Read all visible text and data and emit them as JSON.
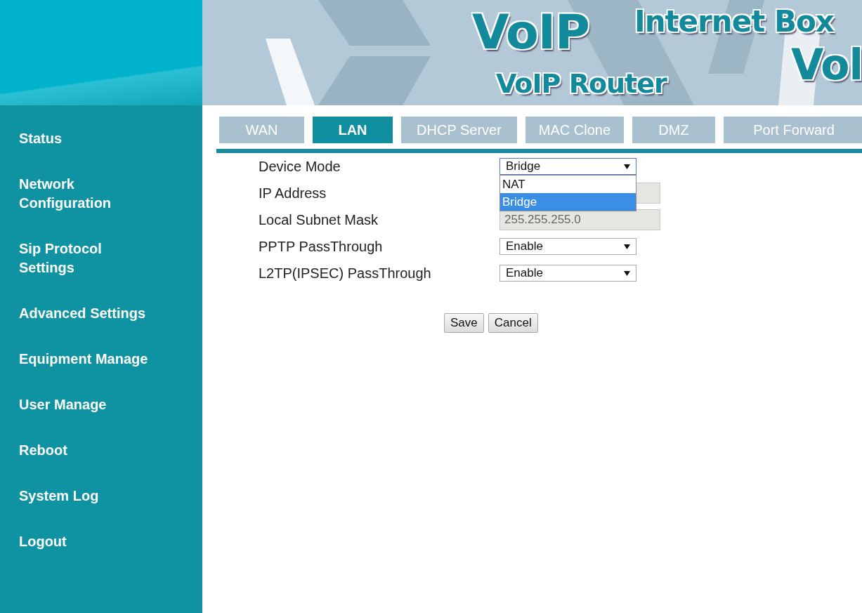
{
  "banner": {
    "logo": "VoIP",
    "tagline": "Internet Box",
    "product": "VoIP Router",
    "logo_repeat": "Vol"
  },
  "sidebar": {
    "items": [
      {
        "label": "Status"
      },
      {
        "label": "Network Configuration"
      },
      {
        "label": "Sip Protocol Settings"
      },
      {
        "label": "Advanced Settings"
      },
      {
        "label": "Equipment Manage"
      },
      {
        "label": "User Manage"
      },
      {
        "label": "Reboot"
      },
      {
        "label": "System Log"
      },
      {
        "label": "Logout"
      }
    ]
  },
  "tabs": [
    {
      "label": "WAN",
      "selected": false
    },
    {
      "label": "LAN",
      "selected": true
    },
    {
      "label": "DHCP Server",
      "selected": false
    },
    {
      "label": "MAC Clone",
      "selected": false
    },
    {
      "label": "DMZ",
      "selected": false
    },
    {
      "label": "Port Forward",
      "selected": false
    }
  ],
  "form": {
    "fields": [
      {
        "label": "Device Mode",
        "kind": "select",
        "value": "Bridge",
        "open": true,
        "options": [
          {
            "label": "NAT",
            "selected": false
          },
          {
            "label": "Bridge",
            "selected": true
          }
        ]
      },
      {
        "label": "IP Address",
        "kind": "text",
        "disabled": true
      },
      {
        "label": "Local Subnet Mask",
        "kind": "text",
        "value": "255.255.255.0",
        "disabled": true
      },
      {
        "label": "PPTP PassThrough",
        "kind": "select",
        "value": "Enable",
        "open": false
      },
      {
        "label": "L2TP(IPSEC) PassThrough",
        "kind": "select",
        "value": "Enable",
        "open": false
      }
    ]
  },
  "buttons": [
    "Save",
    "Cancel"
  ]
}
